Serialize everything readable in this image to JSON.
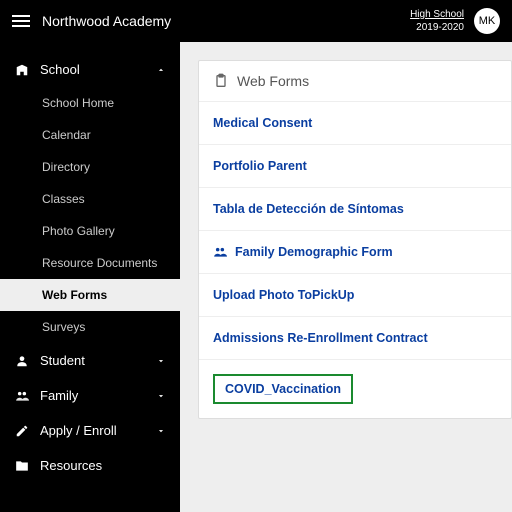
{
  "header": {
    "app_title": "Northwood Academy",
    "context_line1": "High School",
    "context_line2": "2019-2020",
    "avatar_initials": "MK"
  },
  "sidebar": {
    "sections": [
      {
        "name": "School",
        "icon": "building-icon",
        "expanded": true,
        "items": [
          {
            "label": "School Home"
          },
          {
            "label": "Calendar"
          },
          {
            "label": "Directory"
          },
          {
            "label": "Classes"
          },
          {
            "label": "Photo Gallery"
          },
          {
            "label": "Resource Documents"
          },
          {
            "label": "Web Forms",
            "active": true
          },
          {
            "label": "Surveys"
          }
        ]
      },
      {
        "name": "Student",
        "icon": "person-icon",
        "expanded": false
      },
      {
        "name": "Family",
        "icon": "people-icon",
        "expanded": false
      },
      {
        "name": "Apply / Enroll",
        "icon": "pencil-icon",
        "expanded": false
      },
      {
        "name": "Resources",
        "icon": "folder-icon",
        "expanded": false
      }
    ]
  },
  "main": {
    "panel_title": "Web Forms",
    "rows": [
      {
        "label": "Medical Consent"
      },
      {
        "label": "Portfolio Parent"
      },
      {
        "label": "Tabla de Detección de Síntomas"
      },
      {
        "label": "Family Demographic Form",
        "icon": "people-icon"
      },
      {
        "label": "Upload Photo ToPickUp"
      },
      {
        "label": "Admissions Re-Enrollment Contract"
      },
      {
        "label": "COVID_Vaccination",
        "highlighted": true
      }
    ]
  }
}
